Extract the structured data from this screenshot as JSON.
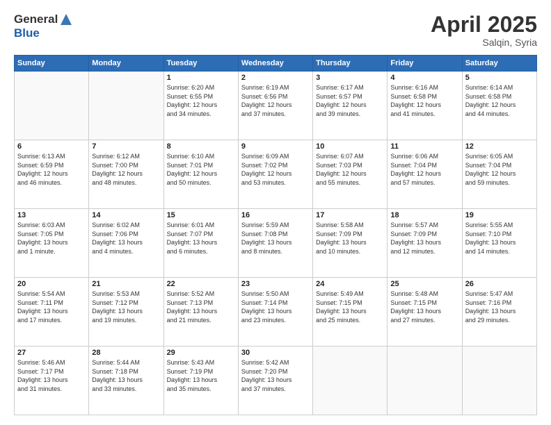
{
  "header": {
    "logo_line1": "General",
    "logo_line2": "Blue",
    "title": "April 2025",
    "location": "Salqin, Syria"
  },
  "weekdays": [
    "Sunday",
    "Monday",
    "Tuesday",
    "Wednesday",
    "Thursday",
    "Friday",
    "Saturday"
  ],
  "weeks": [
    [
      {
        "day": "",
        "info": ""
      },
      {
        "day": "",
        "info": ""
      },
      {
        "day": "1",
        "info": "Sunrise: 6:20 AM\nSunset: 6:55 PM\nDaylight: 12 hours\nand 34 minutes."
      },
      {
        "day": "2",
        "info": "Sunrise: 6:19 AM\nSunset: 6:56 PM\nDaylight: 12 hours\nand 37 minutes."
      },
      {
        "day": "3",
        "info": "Sunrise: 6:17 AM\nSunset: 6:57 PM\nDaylight: 12 hours\nand 39 minutes."
      },
      {
        "day": "4",
        "info": "Sunrise: 6:16 AM\nSunset: 6:58 PM\nDaylight: 12 hours\nand 41 minutes."
      },
      {
        "day": "5",
        "info": "Sunrise: 6:14 AM\nSunset: 6:58 PM\nDaylight: 12 hours\nand 44 minutes."
      }
    ],
    [
      {
        "day": "6",
        "info": "Sunrise: 6:13 AM\nSunset: 6:59 PM\nDaylight: 12 hours\nand 46 minutes."
      },
      {
        "day": "7",
        "info": "Sunrise: 6:12 AM\nSunset: 7:00 PM\nDaylight: 12 hours\nand 48 minutes."
      },
      {
        "day": "8",
        "info": "Sunrise: 6:10 AM\nSunset: 7:01 PM\nDaylight: 12 hours\nand 50 minutes."
      },
      {
        "day": "9",
        "info": "Sunrise: 6:09 AM\nSunset: 7:02 PM\nDaylight: 12 hours\nand 53 minutes."
      },
      {
        "day": "10",
        "info": "Sunrise: 6:07 AM\nSunset: 7:03 PM\nDaylight: 12 hours\nand 55 minutes."
      },
      {
        "day": "11",
        "info": "Sunrise: 6:06 AM\nSunset: 7:04 PM\nDaylight: 12 hours\nand 57 minutes."
      },
      {
        "day": "12",
        "info": "Sunrise: 6:05 AM\nSunset: 7:04 PM\nDaylight: 12 hours\nand 59 minutes."
      }
    ],
    [
      {
        "day": "13",
        "info": "Sunrise: 6:03 AM\nSunset: 7:05 PM\nDaylight: 13 hours\nand 1 minute."
      },
      {
        "day": "14",
        "info": "Sunrise: 6:02 AM\nSunset: 7:06 PM\nDaylight: 13 hours\nand 4 minutes."
      },
      {
        "day": "15",
        "info": "Sunrise: 6:01 AM\nSunset: 7:07 PM\nDaylight: 13 hours\nand 6 minutes."
      },
      {
        "day": "16",
        "info": "Sunrise: 5:59 AM\nSunset: 7:08 PM\nDaylight: 13 hours\nand 8 minutes."
      },
      {
        "day": "17",
        "info": "Sunrise: 5:58 AM\nSunset: 7:09 PM\nDaylight: 13 hours\nand 10 minutes."
      },
      {
        "day": "18",
        "info": "Sunrise: 5:57 AM\nSunset: 7:09 PM\nDaylight: 13 hours\nand 12 minutes."
      },
      {
        "day": "19",
        "info": "Sunrise: 5:55 AM\nSunset: 7:10 PM\nDaylight: 13 hours\nand 14 minutes."
      }
    ],
    [
      {
        "day": "20",
        "info": "Sunrise: 5:54 AM\nSunset: 7:11 PM\nDaylight: 13 hours\nand 17 minutes."
      },
      {
        "day": "21",
        "info": "Sunrise: 5:53 AM\nSunset: 7:12 PM\nDaylight: 13 hours\nand 19 minutes."
      },
      {
        "day": "22",
        "info": "Sunrise: 5:52 AM\nSunset: 7:13 PM\nDaylight: 13 hours\nand 21 minutes."
      },
      {
        "day": "23",
        "info": "Sunrise: 5:50 AM\nSunset: 7:14 PM\nDaylight: 13 hours\nand 23 minutes."
      },
      {
        "day": "24",
        "info": "Sunrise: 5:49 AM\nSunset: 7:15 PM\nDaylight: 13 hours\nand 25 minutes."
      },
      {
        "day": "25",
        "info": "Sunrise: 5:48 AM\nSunset: 7:15 PM\nDaylight: 13 hours\nand 27 minutes."
      },
      {
        "day": "26",
        "info": "Sunrise: 5:47 AM\nSunset: 7:16 PM\nDaylight: 13 hours\nand 29 minutes."
      }
    ],
    [
      {
        "day": "27",
        "info": "Sunrise: 5:46 AM\nSunset: 7:17 PM\nDaylight: 13 hours\nand 31 minutes."
      },
      {
        "day": "28",
        "info": "Sunrise: 5:44 AM\nSunset: 7:18 PM\nDaylight: 13 hours\nand 33 minutes."
      },
      {
        "day": "29",
        "info": "Sunrise: 5:43 AM\nSunset: 7:19 PM\nDaylight: 13 hours\nand 35 minutes."
      },
      {
        "day": "30",
        "info": "Sunrise: 5:42 AM\nSunset: 7:20 PM\nDaylight: 13 hours\nand 37 minutes."
      },
      {
        "day": "",
        "info": ""
      },
      {
        "day": "",
        "info": ""
      },
      {
        "day": "",
        "info": ""
      }
    ]
  ]
}
